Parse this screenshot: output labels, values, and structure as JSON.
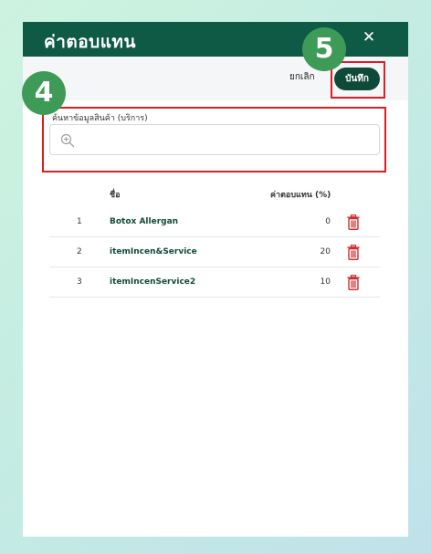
{
  "modal": {
    "title": "ค่าตอบแทน",
    "close_glyph": "✕",
    "cancel_label": "ยกเลิก",
    "save_label": "บันทึก"
  },
  "search": {
    "label": "ค้นหาข้อมูลสินค้า (บริการ)",
    "placeholder": "",
    "value": ""
  },
  "table": {
    "headers": {
      "name": "ชื่อ",
      "value": "ค่าตอบแทน (%)"
    },
    "rows": [
      {
        "index": "1",
        "name": "Botox Allergan",
        "value": "0"
      },
      {
        "index": "2",
        "name": "itemIncen&Service",
        "value": "20"
      },
      {
        "index": "3",
        "name": "itemIncenService2",
        "value": "10"
      }
    ]
  },
  "annotations": {
    "step4": "4",
    "step5": "5"
  },
  "colors": {
    "header_bg": "#0f5a45",
    "save_bg": "#0f4a38",
    "trash": "#d42a2a",
    "highlight": "#e01b24",
    "badge": "#3d9a57"
  },
  "icons": [
    "close-icon",
    "zoom-in-icon",
    "trash-icon"
  ]
}
